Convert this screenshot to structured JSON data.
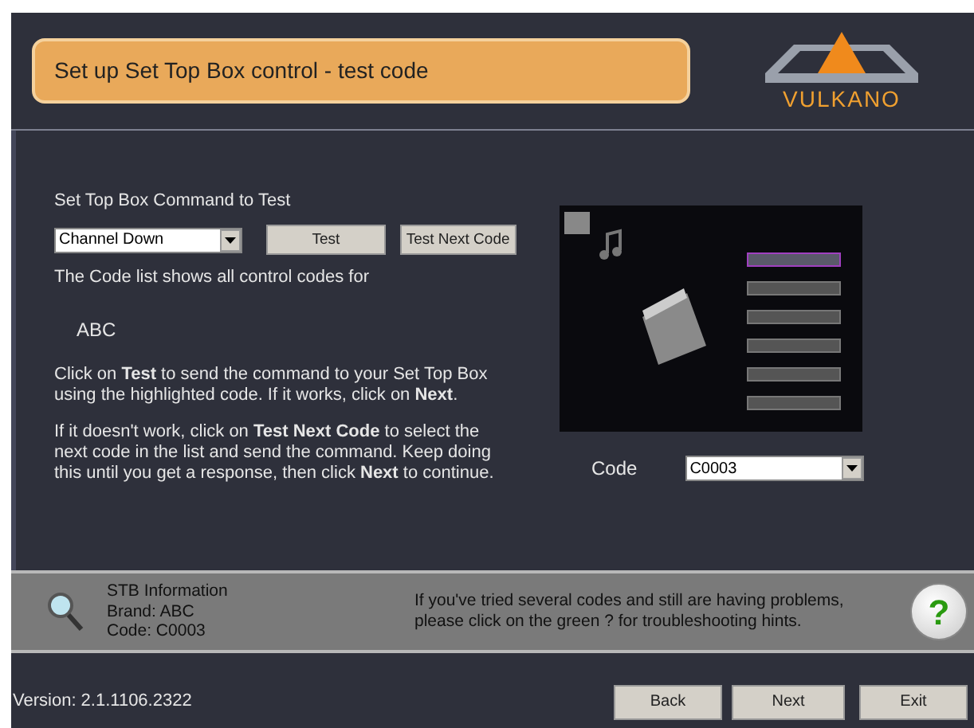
{
  "header": {
    "title": "Set up Set Top Box control - test code",
    "logo_text": "VULKANO"
  },
  "command": {
    "label": "Set Top Box Command to Test",
    "value": "Channel Down"
  },
  "test_buttons": [
    {
      "label": "Test"
    },
    {
      "label": "Test Next Code"
    }
  ],
  "code_list_text": "The Code list shows all control codes for",
  "brand": "ABC",
  "instructions": [
    "Click on **Test** to send the command to your Set Top Box using the highlighted code. If it works, click on **Next**.",
    "If it doesn't work, click on **Test Next Code** to select the next code in the list and send the command. Keep doing this until you get a response, then click **Next** to continue."
  ],
  "code": {
    "label": "Code",
    "value": "C0003"
  },
  "info": {
    "lines": [
      "STB Information",
      "Brand: ABC",
      "Code: C0003"
    ],
    "hint": "If you've tried several codes and still are having problems, please click on the green ? for troubleshooting hints.",
    "help": "?"
  },
  "footer": {
    "version": "Version: 2.1.1106.2322",
    "buttons": [
      "Back",
      "Next",
      "Exit"
    ]
  }
}
